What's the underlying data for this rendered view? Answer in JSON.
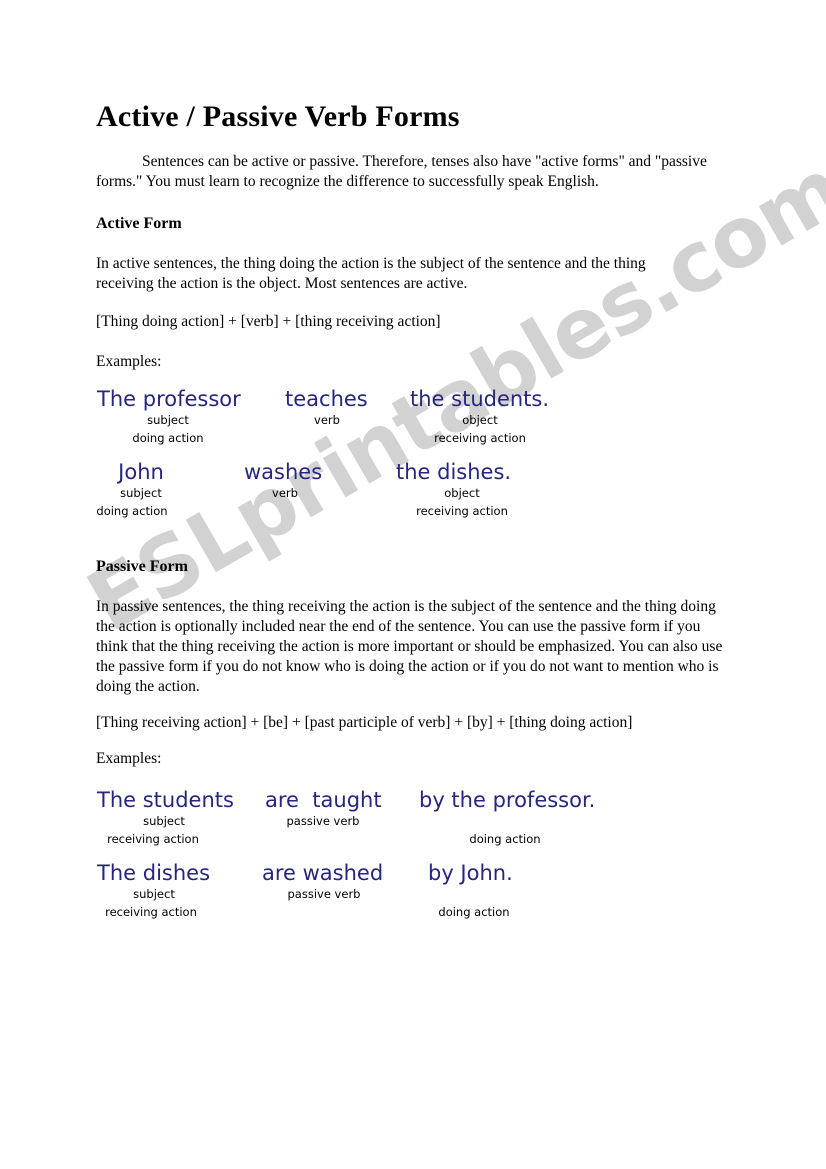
{
  "document": {
    "title": "Active / Passive Verb Forms",
    "watermark": "ESLprintables.com",
    "accent_color": "#262680",
    "watermark_color": "#d2d2d2",
    "intro": "Sentences can be active or passive. Therefore, tenses also have \"active forms\" and \"passive forms.\" You must learn to recognize the difference to successfully speak English."
  },
  "active_section": {
    "heading": "Active Form",
    "body": "In active sentences, the thing doing the action is the subject of the sentence and the thing receiving the action is the object. Most sentences are active.",
    "formula": "[Thing doing action] + [verb] + [thing receiving action]",
    "examples_label": "Examples:",
    "examples": [
      {
        "subject": "The professor",
        "subject_label1": "subject",
        "subject_label2": "doing action",
        "verb": "teaches",
        "verb_label": "verb",
        "object": "the students",
        "object_period": ".",
        "object_label1": "object",
        "object_label2": "receiving action"
      },
      {
        "subject": "John",
        "subject_label1": "subject",
        "subject_label2": "doing action",
        "verb": "washes",
        "verb_label": "verb",
        "object": "the dishes",
        "object_period": ".",
        "object_label1": "object",
        "object_label2": "receiving action"
      }
    ]
  },
  "passive_section": {
    "heading": "Passive Form",
    "body": "In passive sentences, the thing receiving the action is the subject of the sentence and the thing doing the action is optionally included near the end of the sentence. You can use the passive form if you think that the thing receiving the action is more important or should be emphasized. You can also use the passive form if you do not know who is doing the action or if you do not want to mention who is doing the action.",
    "formula": "[Thing receiving action] + [be] + [past participle of verb] + [by] + [thing doing action]",
    "examples_label": "Examples:",
    "examples": [
      {
        "subject": "The students",
        "subject_label1": "subject",
        "subject_label2": "receiving action",
        "verb": "are  taught",
        "verb_label": "passive verb",
        "agent": "by the professor",
        "agent_period": ".",
        "agent_label": "doing action"
      },
      {
        "subject": "The dishes",
        "subject_label1": "subject",
        "subject_label2": "receiving action",
        "verb": "are washed",
        "verb_label": "passive verb",
        "agent": "by John",
        "agent_period": ".",
        "agent_label": "doing action"
      }
    ]
  }
}
